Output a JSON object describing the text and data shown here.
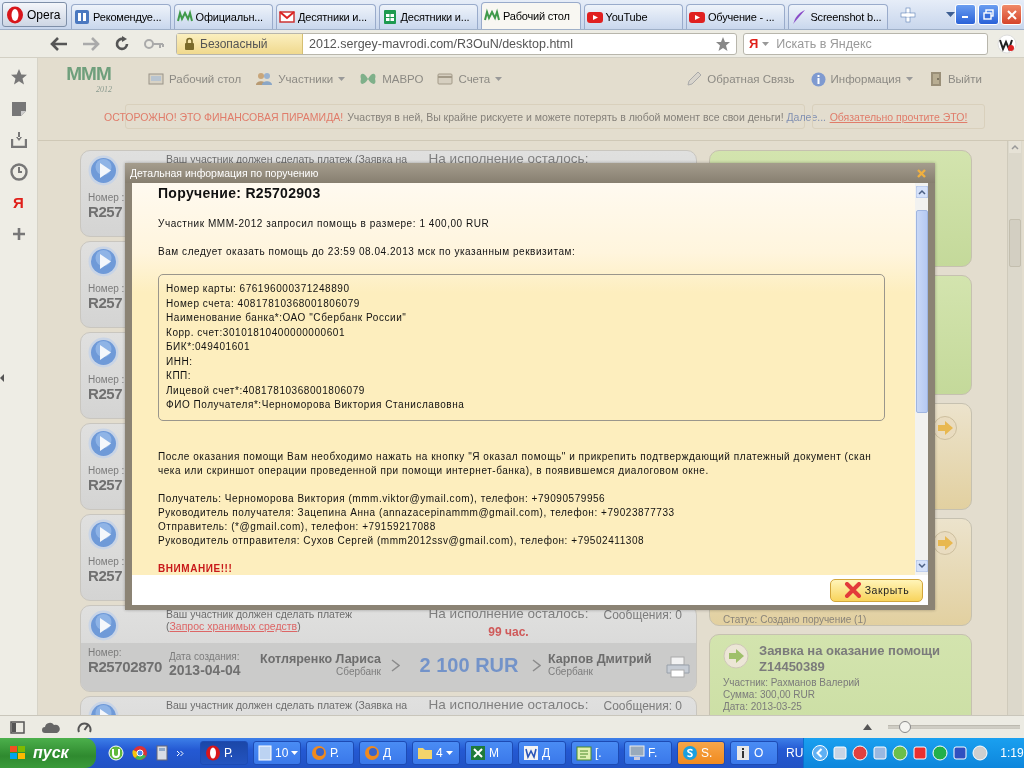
{
  "tab_bar": {
    "menu_button": "Opera",
    "tabs": [
      {
        "label": "Рекомендуе...",
        "kind": "panel",
        "selected": false
      },
      {
        "label": "Официальн...",
        "kind": "mmm",
        "selected": false
      },
      {
        "label": "Десятники и...",
        "kind": "mail",
        "selected": false
      },
      {
        "label": "Десятники и...",
        "kind": "sheet",
        "selected": false
      },
      {
        "label": "Рабочий стол",
        "kind": "mmm",
        "selected": true
      },
      {
        "label": "YouTube",
        "kind": "video",
        "selected": false
      },
      {
        "label": "Обучение - ...",
        "kind": "video",
        "selected": false
      },
      {
        "label": "Screenshot b...",
        "kind": "feather",
        "selected": false
      }
    ]
  },
  "address_bar": {
    "security": "Безопасный",
    "url": "2012.sergey-mavrodi.com/R3OuN/desktop.html",
    "search_engine": "Я",
    "search": {
      "placeholder": "Искать в Яндекс"
    }
  },
  "side_panel": {
    "yandex_label": "Я"
  },
  "site": {
    "logo": {
      "letters": "MMM",
      "year": "2012"
    },
    "nav": [
      {
        "label": "Рабочий стол",
        "kind": "desk",
        "dropdown": false
      },
      {
        "label": "Участники",
        "kind": "people",
        "dropdown": true
      },
      {
        "label": "МАВРО",
        "kind": "butterfly",
        "dropdown": false
      },
      {
        "label": "Счета",
        "kind": "accounts",
        "dropdown": true
      }
    ],
    "nav_right": [
      {
        "label": "Обратная Связь",
        "kind": "pencil",
        "dropdown": false
      },
      {
        "label": "Информация",
        "kind": "info",
        "dropdown": true
      },
      {
        "label": "Выйти",
        "kind": "door",
        "dropdown": false
      }
    ],
    "banner": {
      "warning": "ОСТОРОЖНО! ЭТО ФИНАНСОВАЯ ПИРАМИДА!",
      "message": "Участвуя в ней, Вы крайне рискуете и можете потерять в любой момент все свои деньги!",
      "link": "Далее...",
      "notice_link": "Обязательно прочтите ЭТО!"
    },
    "orders": [
      {
        "note": "Ваш участник должен сделать платеж (Заявка на",
        "remaining_label": "На исполнение осталось:",
        "number_label": "Номер :",
        "number": "R257"
      },
      {
        "number_label": "Номер :",
        "number": "R257"
      },
      {
        "number_label": "Номер :",
        "number": "R257"
      },
      {
        "number_label": "Номер :",
        "number": "R257"
      },
      {
        "number_label": "Номер :",
        "number": "R257"
      },
      {
        "note": "Ваш участник должен сделать платеж (",
        "note_link": "Запрос хранимых средств",
        "note_end": ")",
        "remaining_label": "На исполнение осталось:",
        "remaining": "99 час.",
        "messages": "Сообщения: 0",
        "number_label": "Номер:",
        "number": "R25702870",
        "date_label": "Дата создания:",
        "date": "2013-04-04",
        "payer": "Котляренко Лариса",
        "payer_bank": "Сбербанк",
        "amount": "2 100 RUR",
        "receiver": "Карпов Дмитрий",
        "receiver_bank": "Сбербанк"
      },
      {
        "note": "Ваш участник должен сделать платеж (Заявка на",
        "remaining_label": "На исполнение осталось:",
        "messages": "Сообщения: 0"
      }
    ],
    "side_cards": [
      {
        "kind": "request"
      },
      {
        "kind": "request"
      },
      {
        "kind": "order"
      },
      {
        "kind": "order",
        "status": "Статус: Создано поручение (1)"
      },
      {
        "kind": "request",
        "title": "Заявка на оказание помощи",
        "number": "Z14450389",
        "lines": [
          "Участник: Рахманов Валерий",
          "Сумма: 300,00 RUR",
          "Дата: 2013-03-25"
        ]
      }
    ]
  },
  "dialog": {
    "title": "Детальная информация по поручению",
    "heading": "Поручение: R25702903",
    "intro": "Участник МММ-2012 запросил помощь в размере: 1 400,00 RUR",
    "deadline": "Вам следует оказать помощь до 23:59 08.04.2013 мск по указанным реквизитам:",
    "details": [
      "Номер карты: 676196000371248890",
      "Номер счета: 40817810368001806079",
      "Наименование банка*:ОАО \"Сбербанк России\"",
      "Корр. счет:30101810400000000601",
      "БИК*:049401601",
      "ИНН:",
      "КПП:",
      "Лицевой счет*:40817810368001806079",
      "ФИО Получателя*:Черноморова Виктория Станиславовна"
    ],
    "instruction": "После оказания помощи Вам необходимо нажать на кнопку \"Я оказал помощь\" и прикрепить подтверждающий платежный документ (скан чека или скриншот операции проведенной при помощи интернет-банка), в появившемся диалоговом окне.",
    "contacts": [
      "Получатель: Черноморова Виктория (mmm.viktor@ymail.com), телефон: +79090579956",
      "Руководитель получателя: Зацепина Анна (annazacepinammm@gmail.com), телефон: +79023877733",
      "Отправитель: (*@gmail.com), телефон: +79159217088",
      "Руководитель отправителя: Сухов Сергей (mmm2012ssv@gmail.com), телефон: +79502411308"
    ],
    "warning": "ВНИМАНИЕ!!!",
    "close_button": "Закрыть"
  },
  "status_bar": {
    "zoom": {
      "level": 0.13
    }
  },
  "taskbar": {
    "start": "пуск",
    "tasks": [
      {
        "label": "Р.",
        "kind": "opera",
        "selected": true,
        "flashing": false,
        "menu": false
      },
      {
        "label": "10",
        "kind": "doc",
        "selected": false,
        "flashing": false,
        "menu": true
      },
      {
        "label": "Р.",
        "kind": "firefox",
        "selected": false,
        "flashing": false,
        "menu": false
      },
      {
        "label": "Д",
        "kind": "firefox",
        "selected": false,
        "flashing": false,
        "menu": false
      },
      {
        "label": "4",
        "kind": "folder",
        "selected": false,
        "flashing": false,
        "menu": true
      },
      {
        "label": "М",
        "kind": "excel",
        "selected": false,
        "flashing": false,
        "menu": false
      },
      {
        "label": "Д",
        "kind": "word",
        "selected": false,
        "flashing": false,
        "menu": false
      },
      {
        "label": "[.",
        "kind": "notepad",
        "selected": false,
        "flashing": false,
        "menu": false
      },
      {
        "label": "F.",
        "kind": "computer",
        "selected": false,
        "flashing": false,
        "menu": false
      },
      {
        "label": "S.",
        "kind": "skype",
        "selected": false,
        "flashing": true,
        "menu": false
      },
      {
        "label": "О",
        "kind": "info",
        "selected": false,
        "flashing": false,
        "menu": false
      }
    ],
    "language": "RU",
    "clock": "1:19"
  }
}
